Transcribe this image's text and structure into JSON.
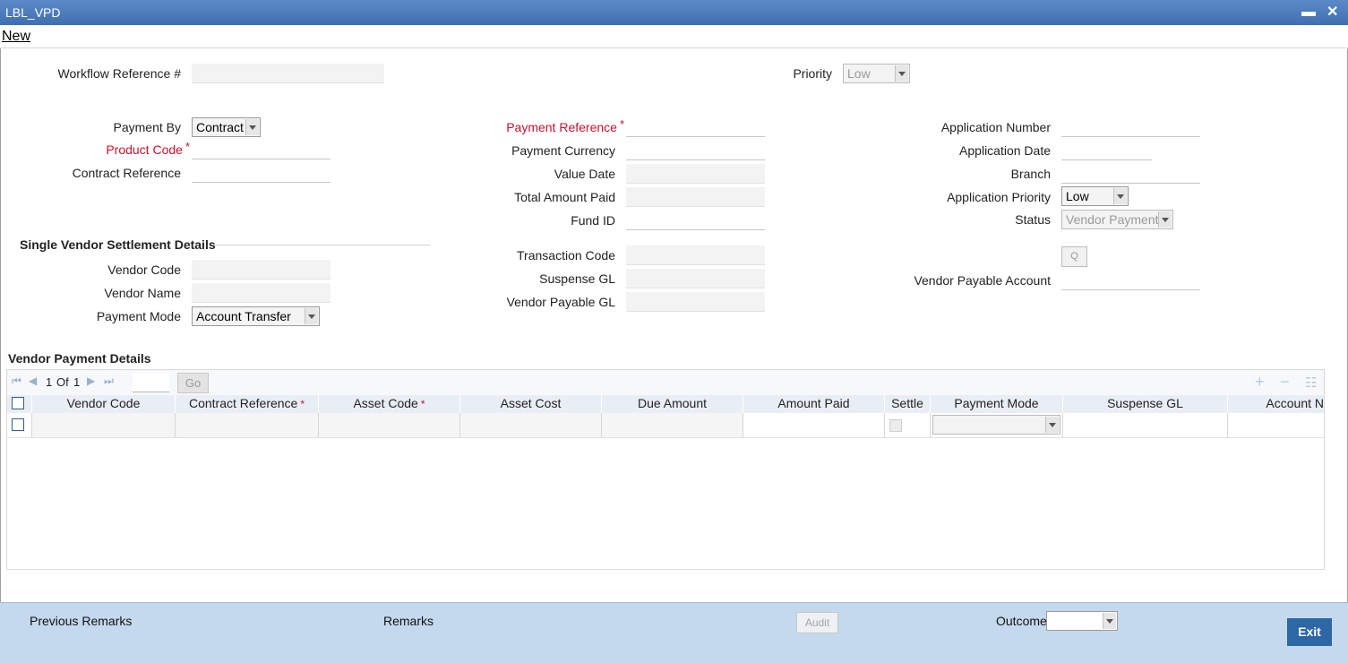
{
  "window": {
    "title": "LBL_VPD",
    "minimize_glyph": "▬",
    "close_glyph": "✕"
  },
  "menu": {
    "new_label": "New"
  },
  "header": {
    "workflow_ref_label": "Workflow Reference #",
    "workflow_ref_value": "",
    "priority_label": "Priority",
    "priority_value": "Low"
  },
  "left": {
    "payment_by_label": "Payment By",
    "payment_by_value": "Contract",
    "product_code_label": "Product Code",
    "product_code_value": "",
    "contract_ref_label": "Contract Reference",
    "contract_ref_value": ""
  },
  "middle": {
    "payment_ref_label": "Payment Reference",
    "payment_currency_label": "Payment Currency",
    "value_date_label": "Value Date",
    "total_amount_paid_label": "Total Amount Paid",
    "fund_id_label": "Fund ID",
    "transaction_code_label": "Transaction Code",
    "suspense_gl_label": "Suspense GL",
    "vendor_payable_gl_label": "Vendor Payable GL"
  },
  "right": {
    "application_number_label": "Application Number",
    "application_date_label": "Application Date",
    "branch_label": "Branch",
    "application_priority_label": "Application Priority",
    "application_priority_value": "Low",
    "status_label": "Status",
    "status_value": "Vendor Payment",
    "q_button_label": "Q",
    "vendor_payable_account_label": "Vendor Payable Account"
  },
  "single_vendor": {
    "title": "Single Vendor Settlement Details",
    "vendor_code_label": "Vendor Code",
    "vendor_name_label": "Vendor Name",
    "payment_mode_label": "Payment Mode",
    "payment_mode_value": "Account Transfer"
  },
  "vendor_payment_details": {
    "title": "Vendor Payment Details",
    "pager": {
      "current": "1",
      "of_label": "Of",
      "total": "1",
      "go_label": "Go"
    },
    "columns": [
      {
        "label": "Vendor Code",
        "required": false
      },
      {
        "label": "Contract Reference",
        "required": true
      },
      {
        "label": "Asset Code",
        "required": true
      },
      {
        "label": "Asset Cost",
        "required": false
      },
      {
        "label": "Due Amount",
        "required": false
      },
      {
        "label": "Amount Paid",
        "required": false
      },
      {
        "label": "Settle",
        "required": false
      },
      {
        "label": "Payment Mode",
        "required": false
      },
      {
        "label": "Suspense GL",
        "required": false
      },
      {
        "label": "Account N",
        "required": false
      }
    ],
    "required_mark": "*"
  },
  "footer": {
    "previous_remarks_label": "Previous Remarks",
    "remarks_label": "Remarks",
    "audit_label": "Audit",
    "outcome_label": "Outcome",
    "outcome_value": "",
    "exit_label": "Exit"
  },
  "required_mark": "*",
  "colors": {
    "titlebar": "#4a7cbd",
    "footer": "#c4d9ee",
    "required": "#c8102e",
    "exit_button": "#2e67a6"
  }
}
